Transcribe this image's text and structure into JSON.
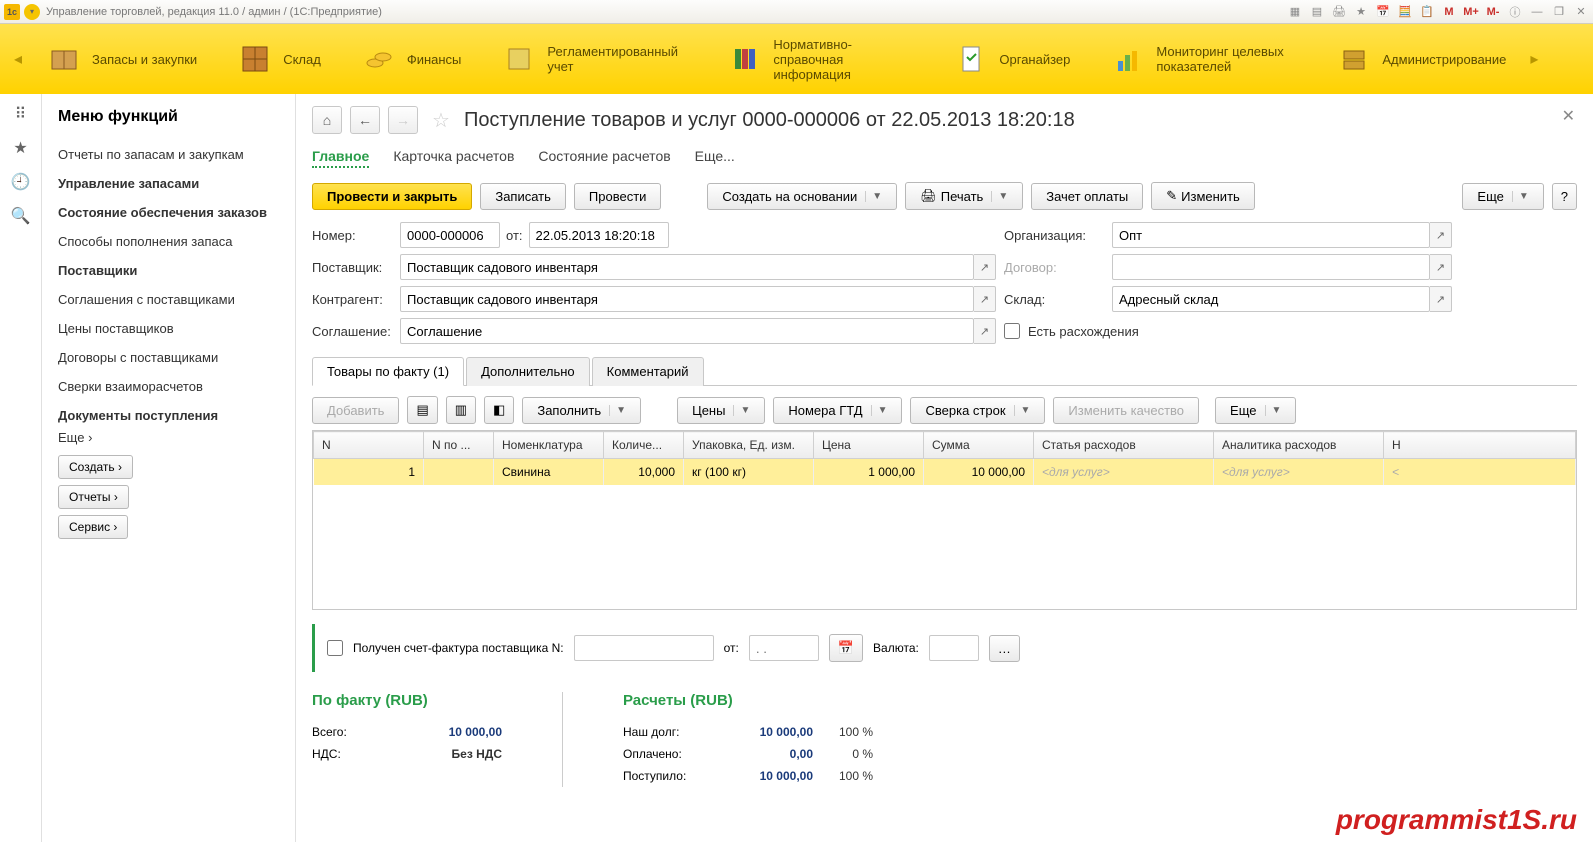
{
  "titlebar": {
    "title": "Управление торговлей, редакция 11.0 / админ /   (1С:Предприятие)",
    "m": "M",
    "mplus": "M+",
    "mminus": "M-"
  },
  "mainbar": {
    "sections": [
      {
        "label": "Запасы и закупки"
      },
      {
        "label": "Склад"
      },
      {
        "label": "Финансы"
      },
      {
        "label": "Регламентированный учет"
      },
      {
        "label": "Нормативно-справочная информация"
      },
      {
        "label": "Органайзер"
      },
      {
        "label": "Мониторинг целевых показателей"
      },
      {
        "label": "Администрирование"
      }
    ]
  },
  "sidepanel": {
    "title": "Меню функций",
    "items": [
      {
        "label": "Отчеты по запасам и закупкам",
        "bold": false
      },
      {
        "label": "Управление запасами",
        "bold": true
      },
      {
        "label": "Состояние обеспечения заказов",
        "bold": true
      },
      {
        "label": "Способы пополнения запаса",
        "bold": false
      },
      {
        "label": "Поставщики",
        "bold": true
      },
      {
        "label": "Соглашения с поставщиками",
        "bold": false
      },
      {
        "label": "Цены поставщиков",
        "bold": false
      },
      {
        "label": "Договоры с поставщиками",
        "bold": false
      },
      {
        "label": "Сверки взаиморасчетов",
        "bold": false
      },
      {
        "label": "Документы поступления",
        "bold": true
      }
    ],
    "more": "Еще ›",
    "buttons": {
      "create": "Создать ›",
      "reports": "Отчеты ›",
      "service": "Сервис ›"
    }
  },
  "doc": {
    "title": "Поступление товаров и услуг 0000-000006 от 22.05.2013 18:20:18",
    "tabs": {
      "main": "Главное",
      "card": "Карточка расчетов",
      "state": "Состояние расчетов",
      "more": "Еще..."
    },
    "toolbar": {
      "post_close": "Провести и закрыть",
      "save": "Записать",
      "post": "Провести",
      "create_based": "Создать на основании",
      "print": "Печать",
      "offset": "Зачет оплаты",
      "edit": "Изменить",
      "more": "Еще",
      "help": "?"
    },
    "form": {
      "number_lbl": "Номер:",
      "number": "0000-000006",
      "date_lbl": "от:",
      "date": "22.05.2013 18:20:18",
      "org_lbl": "Организация:",
      "org": "Опт",
      "supplier_lbl": "Поставщик:",
      "supplier": "Поставщик садового инвентаря",
      "contract_lbl": "Договор:",
      "contract": "",
      "contragent_lbl": "Контрагент:",
      "contragent": "Поставщик садового инвентаря",
      "warehouse_lbl": "Склад:",
      "warehouse": "Адресный склад",
      "agreement_lbl": "Соглашение:",
      "agreement": "Соглашение",
      "discrepancy_lbl": "Есть расхождения"
    },
    "subtabs": {
      "goods": "Товары по факту (1)",
      "extra": "Дополнительно",
      "comment": "Комментарий"
    },
    "table_toolbar": {
      "add": "Добавить",
      "fill": "Заполнить",
      "prices": "Цены",
      "gtd": "Номера ГТД",
      "check": "Сверка строк",
      "quality": "Изменить качество",
      "more": "Еще"
    },
    "table": {
      "headers": {
        "n": "N",
        "npo": "N по ...",
        "nomen": "Номенклатура",
        "qty": "Количе...",
        "pack": "Упаковка, Ед. изм.",
        "price": "Цена",
        "sum": "Сумма",
        "exp_item": "Статья расходов",
        "exp_anal": "Аналитика расходов",
        "last": "Н"
      },
      "rows": [
        {
          "n": "1",
          "npo": "",
          "nomen": "Свинина",
          "qty": "10,000",
          "pack": "кг (100 кг)",
          "price": "1 000,00",
          "sum": "10 000,00",
          "exp_item": "<для услуг>",
          "exp_anal": "<для услуг>"
        }
      ]
    },
    "invoice": {
      "label": "Получен счет-фактура поставщика N:",
      "from": "от:",
      "date_placeholder": ". .",
      "currency": "Валюта:"
    },
    "totals": {
      "fact_title": "По факту (RUB)",
      "calc_title": "Расчеты (RUB)",
      "total_lbl": "Всего:",
      "total_val": "10 000,00",
      "vat_lbl": "НДС:",
      "vat_val": "Без НДС",
      "debt_lbl": "Наш долг:",
      "debt_val": "10 000,00",
      "debt_pct": "100 %",
      "paid_lbl": "Оплачено:",
      "paid_val": "0,00",
      "paid_pct": "0 %",
      "received_lbl": "Поступило:",
      "received_val": "10 000,00",
      "received_pct": "100 %"
    }
  },
  "watermark": "programmist1S.ru"
}
